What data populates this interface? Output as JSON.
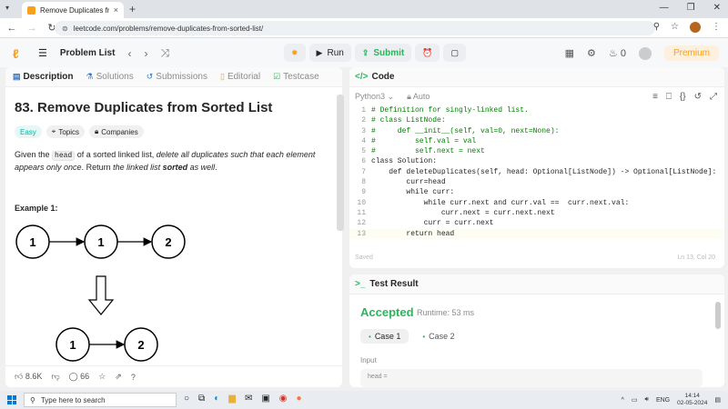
{
  "browser": {
    "tab_title": "Remove Duplicates from Sorte...",
    "tab_close": "×",
    "new_tab": "+",
    "url": "leetcode.com/problems/remove-duplicates-from-sorted-list/",
    "window_controls": [
      "—",
      "❐",
      "✕"
    ]
  },
  "header": {
    "problem_list_label": "Problem List",
    "run_label": "Run",
    "submit_label": "Submit",
    "streak_count": "0",
    "premium_label": "Premium"
  },
  "left_tabs": [
    {
      "label": "Description",
      "icon": "description-icon"
    },
    {
      "label": "Solutions",
      "icon": "flask-icon"
    },
    {
      "label": "Submissions",
      "icon": "history-icon"
    },
    {
      "label": "Editorial",
      "icon": "book-icon"
    },
    {
      "label": "Testcase",
      "icon": "check-box-icon"
    }
  ],
  "problem": {
    "title": "83. Remove Duplicates from Sorted List",
    "difficulty": "Easy",
    "topics_label": "Topics",
    "companies_label": "Companies",
    "desc_given": "Given the ",
    "desc_code": "head",
    "desc_mid": " of a sorted linked list, ",
    "desc_em": "delete all duplicates such that each element appears only once",
    "desc_after": ". Return ",
    "desc_em2": "the linked list ",
    "desc_strong": "sorted",
    "desc_em3": " as well",
    "desc_end": ".",
    "example_label": "Example 1:",
    "diagram_top": [
      "1",
      "1",
      "2"
    ],
    "diagram_bottom": [
      "1",
      "2"
    ],
    "likes": "8.6K",
    "comments": "66"
  },
  "code": {
    "panel_title": "Code",
    "language": "Python3",
    "auto_label": "Auto",
    "lines": [
      {
        "n": "1",
        "t": "# Definition for singly-linked list."
      },
      {
        "n": "2",
        "t": "# class ListNode:"
      },
      {
        "n": "3",
        "t": "#     def __init__(self, val=0, next=None):"
      },
      {
        "n": "4",
        "t": "#         self.val = val"
      },
      {
        "n": "5",
        "t": "#         self.next = next"
      },
      {
        "n": "6",
        "t": "class Solution:"
      },
      {
        "n": "7",
        "t": "    def deleteDuplicates(self, head: Optional[ListNode]) -> Optional[ListNode]:"
      },
      {
        "n": "8",
        "t": "        curr=head"
      },
      {
        "n": "9",
        "t": "        while curr:"
      },
      {
        "n": "10",
        "t": "            while curr.next and curr.val ==  curr.next.val:"
      },
      {
        "n": "11",
        "t": "                curr.next = curr.next.next"
      },
      {
        "n": "12",
        "t": "            curr = curr.next"
      },
      {
        "n": "13",
        "t": "        return head"
      }
    ],
    "saved_label": "Saved",
    "cursor_pos": "Ln 13, Col 20"
  },
  "test": {
    "panel_title": "Test Result",
    "status": "Accepted",
    "runtime": "Runtime: 53 ms",
    "cases": [
      "Case 1",
      "Case 2"
    ],
    "input_label": "Input",
    "input_value": "head ="
  },
  "taskbar": {
    "search_placeholder": "Type here to search",
    "lang": "ENG",
    "time": "14:14",
    "date": "02-05-2024"
  }
}
